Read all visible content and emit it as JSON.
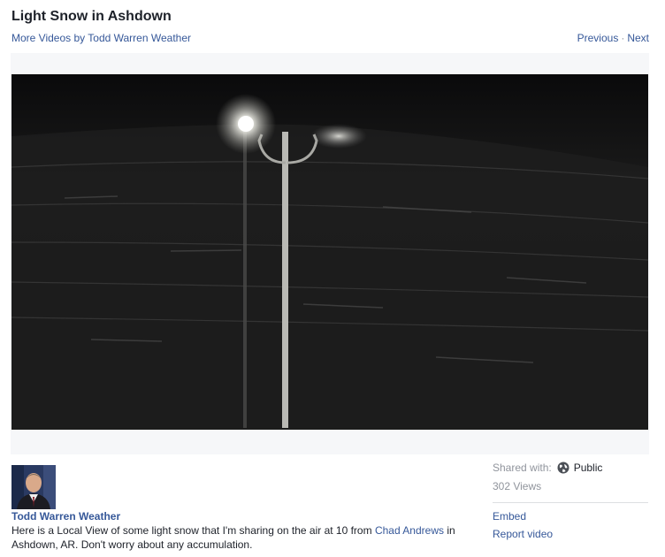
{
  "header": {
    "title": "Light Snow in Ashdown",
    "more_videos": "More Videos by Todd Warren Weather",
    "previous": "Previous",
    "separator": "·",
    "next": "Next"
  },
  "video": {
    "state": "paused",
    "content": "night street light with falling snow"
  },
  "poster": {
    "name": "Todd Warren Weather",
    "avatar": "presenter-photo"
  },
  "description": {
    "text_before": "Here is a Local View of some light snow that I'm sharing on the air at 10 from ",
    "mention": "Chad Andrews",
    "text_after": " in Ashdown, AR. Don't worry about any accumulation."
  },
  "sidebar": {
    "shared_with_label": "Shared with:",
    "privacy_icon": "globe-icon",
    "privacy": "Public",
    "views": "302 Views",
    "embed": "Embed",
    "report": "Report video"
  },
  "colors": {
    "link": "#365899",
    "text": "#1d2129",
    "muted": "#90949c",
    "frame": "#f6f7f9"
  }
}
